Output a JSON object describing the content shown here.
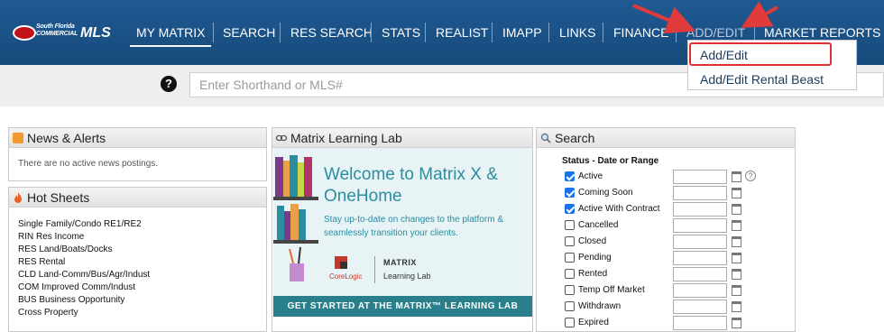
{
  "logo": {
    "line1": "South Florida",
    "line2": "COMMERCIAL",
    "brand": "MLS"
  },
  "nav": {
    "items": [
      "MY MATRIX",
      "SEARCH",
      "RES SEARCH",
      "STATS",
      "REALIST",
      "IMAPP",
      "LINKS",
      "FINANCE",
      "ADD/EDIT",
      "MARKET REPORTS"
    ],
    "active": "MY MATRIX",
    "bg_color": "#1f5a92"
  },
  "dropdown": {
    "items": [
      "Add/Edit",
      "Add/Edit Rental Beast"
    ],
    "highlight_color": "#e03030"
  },
  "search": {
    "placeholder": "Enter Shorthand or MLS#",
    "help_icon": "question-circle-icon"
  },
  "news": {
    "title": "News & Alerts",
    "message": "There are no active news postings."
  },
  "hotsheets": {
    "title": "Hot Sheets",
    "items": [
      "Single Family/Condo RE1/RE2",
      "RIN Res Income",
      "RES Land/Boats/Docks",
      "RES Rental",
      "CLD Land-Comm/Bus/Agr/Indust",
      "COM Improved Comm/Indust",
      "BUS Business Opportunity",
      "Cross Property"
    ]
  },
  "learning_lab": {
    "title": "Matrix Learning Lab",
    "banner_title": "Welcome to Matrix X & OneHome",
    "banner_sub": "Stay up-to-date on changes to the platform & seamlessly transition your clients.",
    "banner_brand": "CoreLogic",
    "banner_product": "MATRIX",
    "banner_product_sub": "Learning Lab",
    "banner_cta": "GET STARTED AT THE MATRIX™ LEARNING LAB"
  },
  "search_panel": {
    "title": "Search",
    "status_heading": "Status - Date or Range",
    "statuses": [
      {
        "label": "Active",
        "checked": true
      },
      {
        "label": "Coming Soon",
        "checked": true
      },
      {
        "label": "Active With Contract",
        "checked": true
      },
      {
        "label": "Cancelled",
        "checked": false
      },
      {
        "label": "Closed",
        "checked": false
      },
      {
        "label": "Pending",
        "checked": false
      },
      {
        "label": "Rented",
        "checked": false
      },
      {
        "label": "Temp Off Market",
        "checked": false
      },
      {
        "label": "Withdrawn",
        "checked": false
      },
      {
        "label": "Expired",
        "checked": false
      }
    ]
  }
}
